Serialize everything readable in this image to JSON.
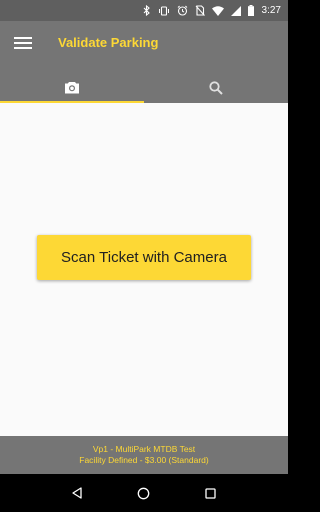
{
  "status_bar": {
    "time": "3:27",
    "icons": [
      "bluetooth-icon",
      "vibrate-icon",
      "alarm-icon",
      "no-sim-icon",
      "wifi-icon",
      "signal-icon",
      "battery-icon"
    ]
  },
  "app_bar": {
    "title": "Validate Parking",
    "menu_icon": "hamburger-menu-icon"
  },
  "tabs": [
    {
      "icon": "camera-icon",
      "active": true
    },
    {
      "icon": "search-icon",
      "active": false
    }
  ],
  "main": {
    "scan_button_label": "Scan Ticket with Camera"
  },
  "footer": {
    "line1": "Vp1 - MultiPark MTDB Test",
    "line2": "Facility Defined - $3.00 (Standard)"
  },
  "nav_bar": {
    "icons": [
      "back-icon",
      "home-icon",
      "recents-icon"
    ]
  },
  "colors": {
    "accent": "#fdd835",
    "app_bar": "#757575",
    "status_bar": "#5f5f5f",
    "content_bg": "#fafafa"
  }
}
